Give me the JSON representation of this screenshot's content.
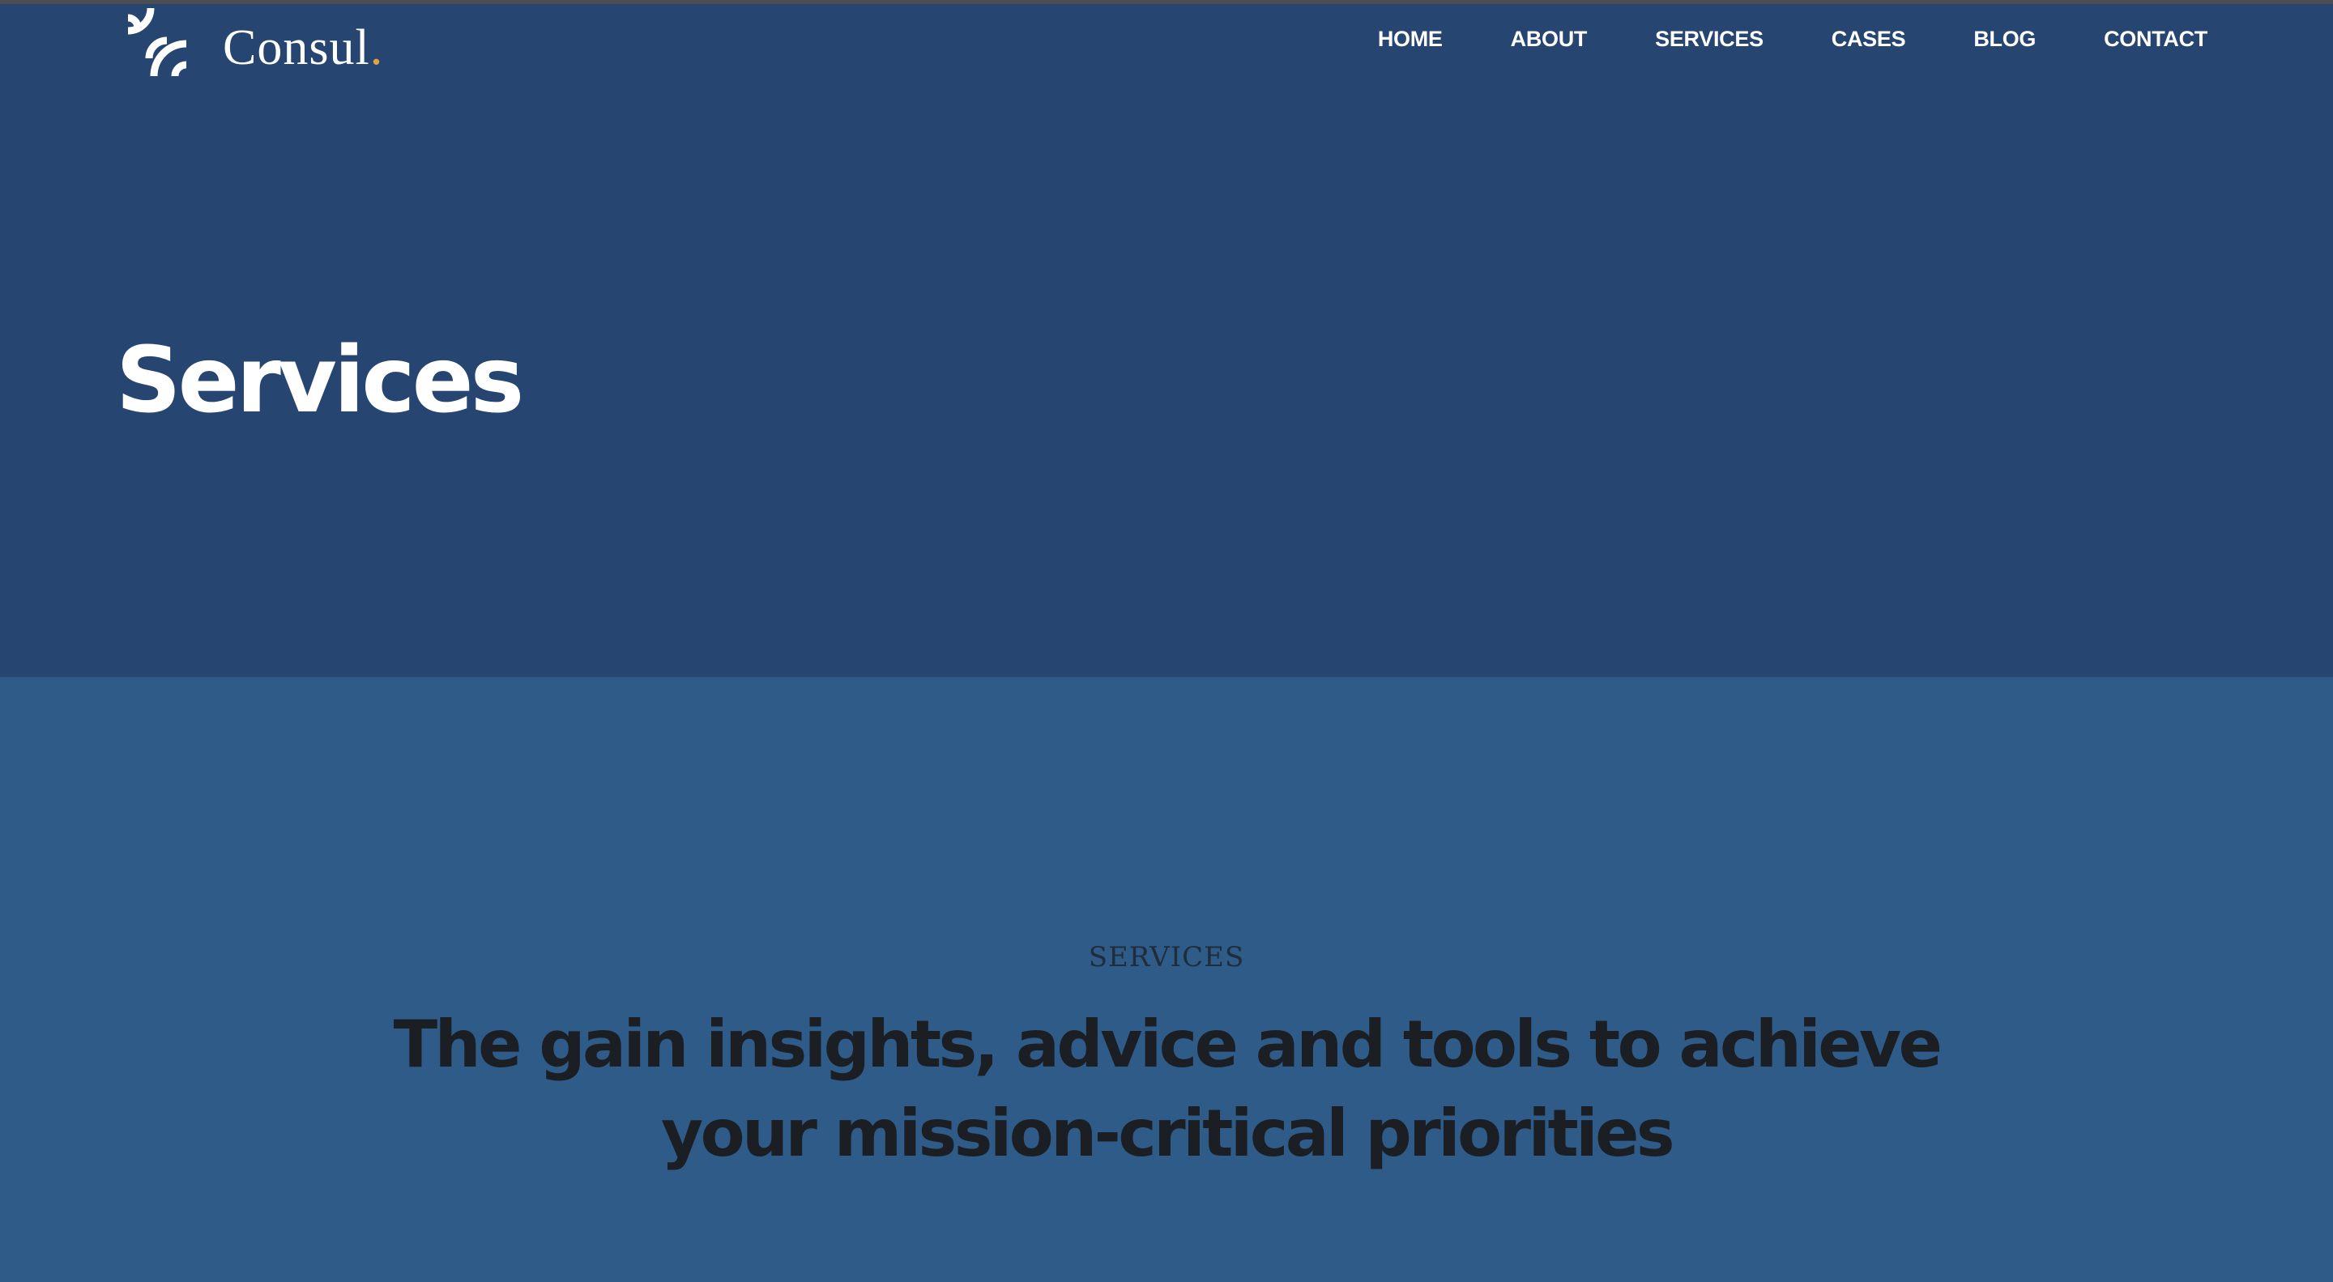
{
  "brand": {
    "name": "Consul",
    "dot": ".",
    "logo_icon": "signal-waves-icon",
    "accent_color": "#e3a23d"
  },
  "nav": {
    "items": [
      {
        "label": "HOME"
      },
      {
        "label": "ABOUT"
      },
      {
        "label": "SERVICES"
      },
      {
        "label": "CASES"
      },
      {
        "label": "BLOG"
      },
      {
        "label": "CONTACT"
      }
    ]
  },
  "hero": {
    "title": "Services",
    "background": "#264571"
  },
  "services_section": {
    "eyebrow": "SERVICES",
    "heading": "The gain insights, advice and tools to achieve your mission-critical priorities",
    "background": "#2f5b88"
  }
}
